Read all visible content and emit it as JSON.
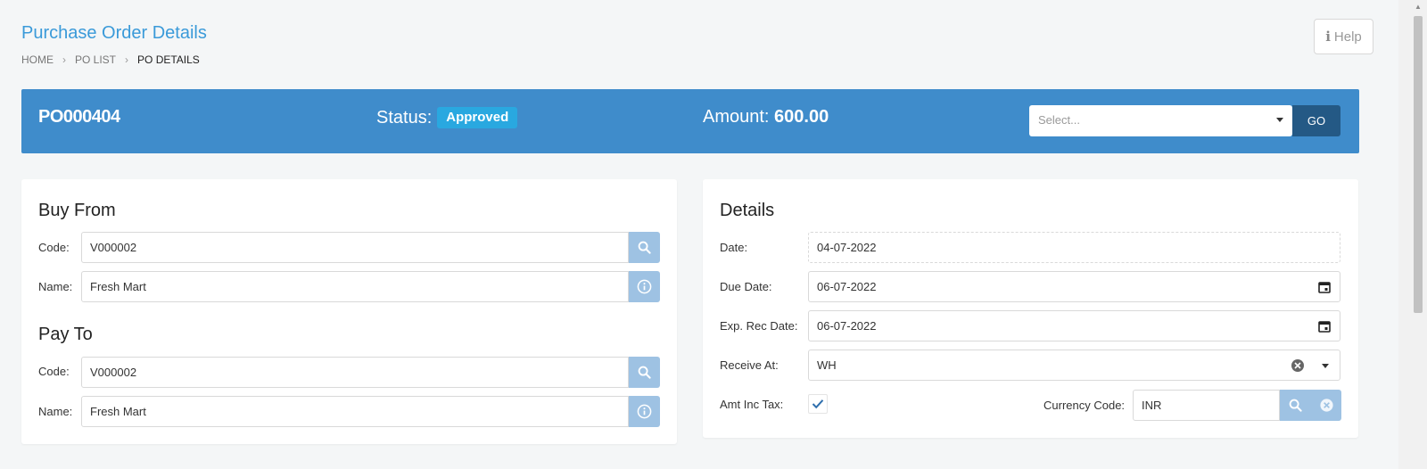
{
  "header": {
    "title": "Purchase Order Details",
    "breadcrumb": [
      "HOME",
      "PO LIST",
      "PO DETAILS"
    ],
    "help_label": "Help"
  },
  "banner": {
    "po_number": "PO000404",
    "status_label": "Status:",
    "status_value": "Approved",
    "amount_label": "Amount:",
    "amount_value": "600.00",
    "action_placeholder": "Select...",
    "go_label": "GO"
  },
  "buy_from": {
    "title": "Buy From",
    "code_label": "Code:",
    "code_value": "V000002",
    "name_label": "Name:",
    "name_value": "Fresh Mart"
  },
  "pay_to": {
    "title": "Pay To",
    "code_label": "Code:",
    "code_value": "V000002",
    "name_label": "Name:",
    "name_value": "Fresh Mart"
  },
  "details": {
    "title": "Details",
    "date_label": "Date:",
    "date_value": "04-07-2022",
    "due_date_label": "Due Date:",
    "due_date_value": "06-07-2022",
    "exp_rec_date_label": "Exp. Rec Date:",
    "exp_rec_date_value": "06-07-2022",
    "receive_at_label": "Receive At:",
    "receive_at_value": "WH",
    "amt_inc_tax_label": "Amt Inc Tax:",
    "amt_inc_tax_checked": true,
    "currency_label": "Currency Code:",
    "currency_value": "INR"
  },
  "colors": {
    "accent": "#3a9ad9",
    "banner": "#3f8ccb",
    "status_badge": "#29a8e0",
    "go_button": "#245985",
    "icon_button": "#9ec2e3"
  }
}
